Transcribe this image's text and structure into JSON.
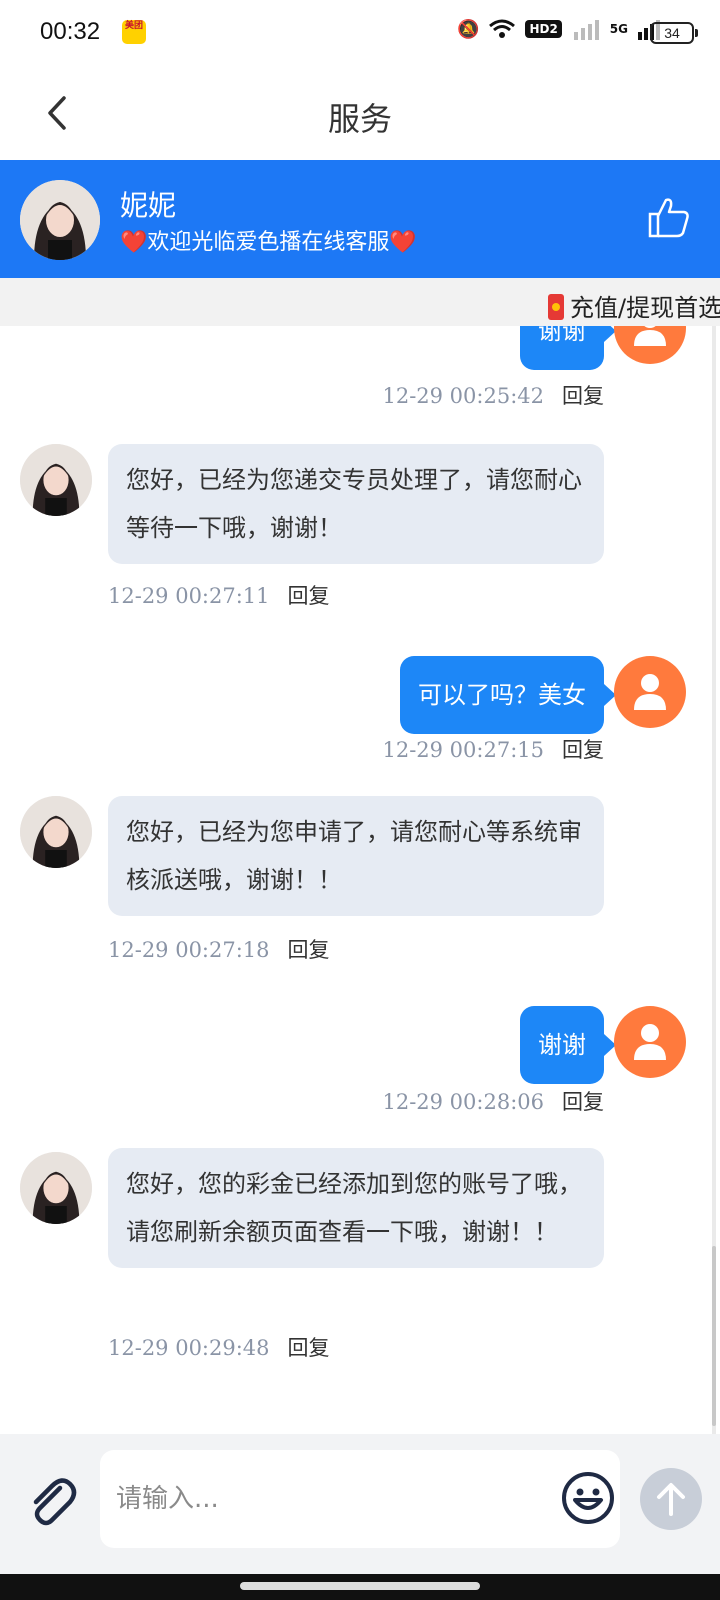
{
  "status_bar": {
    "time": "00:32",
    "app_badge": "美团",
    "battery": "34",
    "network": "5G",
    "hd": "HD2"
  },
  "header": {
    "title": "服务",
    "back_icon": "chevron-left-icon"
  },
  "agent": {
    "name": "妮妮",
    "subtitle": "❤️欢迎光临爱色播在线客服❤️",
    "like_icon": "thumbs-up-icon"
  },
  "marquee": {
    "text": "充值/提现首选"
  },
  "messages": [
    {
      "side": "right",
      "text": "谢谢",
      "time": "12-29 00:25:42",
      "reply": "回复"
    },
    {
      "side": "left",
      "text": "您好，已经为您递交专员处理了，请您耐心等待一下哦，谢谢！",
      "time": "12-29 00:27:11",
      "reply": "回复"
    },
    {
      "side": "right",
      "text": "可以了吗？美女",
      "time": "12-29 00:27:15",
      "reply": "回复"
    },
    {
      "side": "left",
      "text": "您好，已经为您申请了，请您耐心等系统审核派送哦，谢谢！！",
      "time": "12-29 00:27:18",
      "reply": "回复"
    },
    {
      "side": "right",
      "text": "谢谢",
      "time": "12-29 00:28:06",
      "reply": "回复"
    },
    {
      "side": "left",
      "text": "您好，您的彩金已经添加到您的账号了哦，请您刷新余额页面查看一下哦，谢谢！！",
      "time": "12-29 00:29:48",
      "reply": "回复"
    }
  ],
  "input": {
    "placeholder": "请输入..."
  },
  "colors": {
    "accent": "#1d78f5",
    "user_avatar": "#ff7a3d",
    "bubble_left": "#e6ebf3"
  }
}
